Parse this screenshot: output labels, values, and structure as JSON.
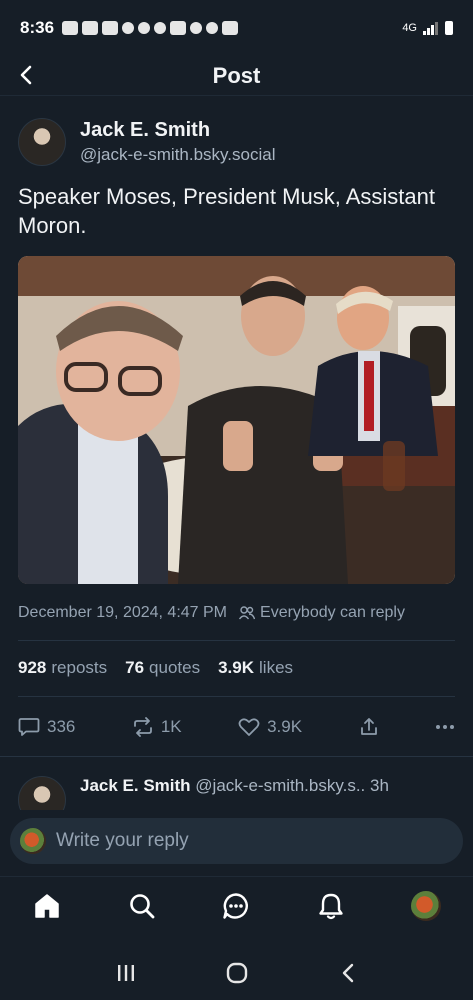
{
  "status_bar": {
    "time": "8:36",
    "network": "4G"
  },
  "header": {
    "title": "Post",
    "back_icon": "chevron-left-icon"
  },
  "post": {
    "author_name": "Jack E. Smith",
    "author_handle": "@jack-e-smith.bsky.social",
    "text": "Speaker Moses, President Musk, Assistant Moron.",
    "image_description_icon": "photo",
    "timestamp": "December 19, 2024, 4:47 PM",
    "reply_permission": "Everybody can reply"
  },
  "stats": {
    "reposts_count": "928",
    "reposts_label": "reposts",
    "quotes_count": "76",
    "quotes_label": "quotes",
    "likes_count": "3.9K",
    "likes_label": "likes"
  },
  "actions": {
    "replies": "336",
    "reposts": "1K",
    "likes": "3.9K"
  },
  "reply_preview": {
    "name": "Jack E. Smith",
    "handle": "@jack-e-smith.bsky.s..",
    "time": "3h"
  },
  "composer": {
    "placeholder": "Write your reply"
  },
  "colors": {
    "background": "#161e27",
    "text": "#f1f3f5",
    "muted": "#95a3b2",
    "divider": "#263341",
    "composer_bg": "#222e3a"
  }
}
